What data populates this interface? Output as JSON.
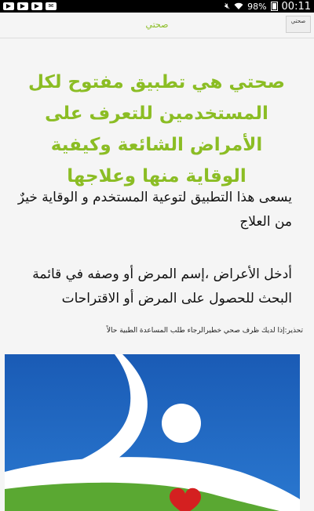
{
  "status_bar": {
    "battery": "98%",
    "time": "00:11"
  },
  "app_bar": {
    "title": "صحتي",
    "corner_button_label": "صحتي"
  },
  "main": {
    "headline": "صحتي هي تطبيق مفتوح لكل المستخدمين للتعرف على الأمراض الشائعة وكيفية الوقاية منها وعلاجها",
    "paragraph1": "يسعى هذا التطبيق لتوعية المستخدم و الوقاية خيرٌ من العلاج",
    "paragraph2": "أدخل الأعراض ،إسم المرض أو وصفه في قائمة البحث للحصول على المرض أو الاقتراحات",
    "warning": "تحذير:إذا لديك ظرف صحي خطيرالرجاء طلب المساعدة الطبية حالاً"
  },
  "colors": {
    "accent_green": "#8bbd24",
    "logo_blue": "#1c5fb8",
    "logo_green": "#5aa832",
    "logo_red": "#d42020"
  }
}
